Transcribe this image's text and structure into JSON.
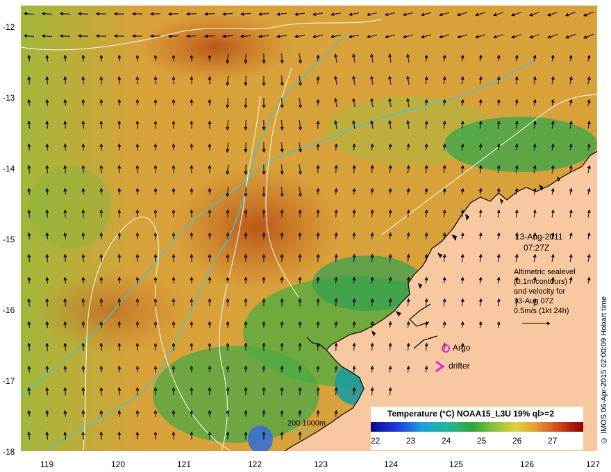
{
  "map": {
    "lon_ticks": [
      "119",
      "120",
      "121",
      "122",
      "123",
      "124",
      "125",
      "126",
      "127"
    ],
    "lat_ticks": [
      "-12",
      "-13",
      "-14",
      "-15",
      "-16",
      "-17",
      "-18"
    ]
  },
  "annotation": {
    "date": "13-Aug-2011",
    "time": "07:27Z",
    "altimetry_line1": "Altimetric sealevel",
    "altimetry_line2": "(0.1m contours)",
    "altimetry_line3": "and velocity for",
    "altimetry_line4": "13-Aug 07Z",
    "scale_label": "0.5m/s (1kt 24h)"
  },
  "markers": {
    "argo_label": "Argo",
    "drifter_label": "drifter"
  },
  "depth_legend": {
    "label": "200  1000m"
  },
  "temperature_legend": {
    "title": "Temperature (°C) NOAA15_L3U 19% ql>=2",
    "ticks": [
      "22",
      "23",
      "24",
      "25",
      "26",
      "27"
    ]
  },
  "credit": "© IMOS 06-Apr-2015 02:00:09 Hobart time",
  "colors": {
    "land": "#f8c8a0",
    "ocean_warm": "#d9a13a",
    "ocean_hot": "#c7631e",
    "ocean_cool": "#49a844",
    "isobath": "#47c6c4",
    "contour": "#ffffff",
    "marker": "#e020e0"
  }
}
